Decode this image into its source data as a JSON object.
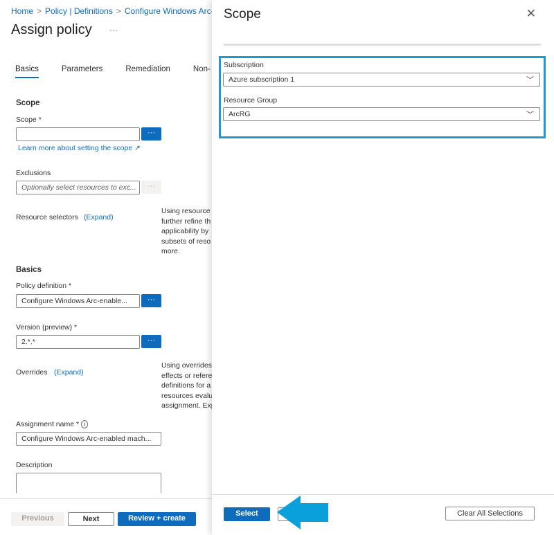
{
  "breadcrumb": [
    "Home",
    "Policy | Definitions",
    "Configure Windows Arc-"
  ],
  "page_title": "Assign policy",
  "more_label": "···",
  "tabs": [
    {
      "label": "Basics",
      "active": true
    },
    {
      "label": "Parameters"
    },
    {
      "label": "Remediation"
    },
    {
      "label": "Non-"
    }
  ],
  "scope_section": {
    "heading": "Scope",
    "scope_label": "Scope *",
    "scope_value": "",
    "browse": "···",
    "learn_more": "Learn more about setting the scope",
    "exclusions_label": "Exclusions",
    "exclusions_placeholder": "Optionally select resources to exc..."
  },
  "resource_selectors": {
    "label": "Resource selectors",
    "expand": "(Expand)",
    "help": [
      "Using resource",
      "further refine th",
      "applicability by",
      "subsets of reso",
      "more."
    ]
  },
  "basics": {
    "heading": "Basics",
    "policy_definition_label": "Policy definition *",
    "policy_definition_value": "Configure Windows Arc-enable...",
    "version_label": "Version (preview) *",
    "version_value": "2.*.*"
  },
  "overrides": {
    "label": "Overrides",
    "expand": "(Expand)",
    "help": [
      "Using overrides",
      "effects or refere",
      "definitions for a",
      "resources evalu",
      "assignment. Exp"
    ]
  },
  "assignment": {
    "name_label": "Assignment name *",
    "name_value": "Configure Windows Arc-enabled mach...",
    "description_label": "Description",
    "description_value": ""
  },
  "footer": {
    "previous": "Previous",
    "next": "Next",
    "review_create": "Review + create"
  },
  "panel": {
    "title": "Scope",
    "close": "✕",
    "subscription_label": "Subscription",
    "subscription_value": "Azure subscription 1",
    "resource_group_label": "Resource Group",
    "resource_group_value": "ArcRG",
    "select": "Select",
    "clear_all": "Clear All Selections"
  },
  "colors": {
    "accent": "#0f6cbd",
    "highlight": "#1a9bd7"
  }
}
